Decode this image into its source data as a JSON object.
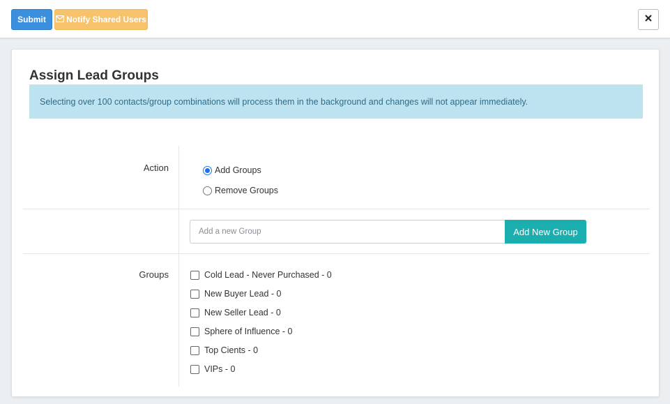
{
  "toolbar": {
    "submit_label": "Submit",
    "notify_label": "Notify Shared Users",
    "close_symbol": "✕"
  },
  "card": {
    "title": "Assign Lead Groups",
    "alert_text": "Selecting over 100 contacts/group combinations will process them in the background and changes will not appear immediately."
  },
  "action": {
    "label": "Action",
    "options": [
      {
        "label": "Add Groups",
        "checked": true
      },
      {
        "label": "Remove Groups",
        "checked": false
      }
    ]
  },
  "add_group": {
    "placeholder": "Add a new Group",
    "value": "",
    "button_label": "Add New Group"
  },
  "groups": {
    "label": "Groups",
    "items": [
      {
        "label": "Cold Lead - Never Purchased - 0",
        "checked": false
      },
      {
        "label": "New Buyer Lead - 0",
        "checked": false
      },
      {
        "label": "New Seller Lead - 0",
        "checked": false
      },
      {
        "label": "Sphere of Influence - 0",
        "checked": false
      },
      {
        "label": "Top Cients - 0",
        "checked": false
      },
      {
        "label": "VIPs - 0",
        "checked": false
      }
    ]
  },
  "colors": {
    "submit": "#3c8fdc",
    "notify": "#f6c26b",
    "alert_bg": "#bde3f1",
    "add_group_button": "#1aaeae"
  }
}
